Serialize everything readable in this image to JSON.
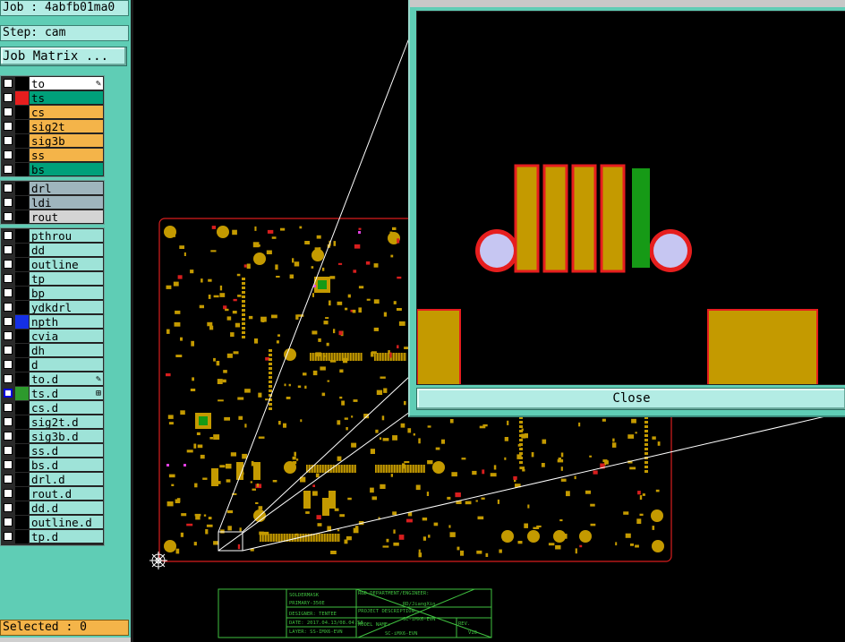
{
  "job_label": "Job : 4abfb01ma0",
  "step_label": "Step: cam",
  "job_matrix_button": "Job Matrix ...",
  "selected_status": "Selected : 0",
  "close_button": "Close",
  "layer_groups": [
    [
      {
        "name": "to",
        "bg": "#ffffff",
        "swatch": "#000000",
        "mark": "edit"
      },
      {
        "name": "ts",
        "bg": "#00a07a",
        "swatch": "#e61e1e"
      },
      {
        "name": "cs",
        "bg": "#f4b449",
        "swatch": "#000000"
      },
      {
        "name": "sig2t",
        "bg": "#f4b449",
        "swatch": "#000000"
      },
      {
        "name": "sig3b",
        "bg": "#f4b449",
        "swatch": "#000000"
      },
      {
        "name": "ss",
        "bg": "#f4b449",
        "swatch": "#000000"
      },
      {
        "name": "bs",
        "bg": "#00a07a",
        "swatch": "#000000"
      }
    ],
    [
      {
        "name": "drl",
        "bg": "#9fb5bd",
        "swatch": "#000000"
      },
      {
        "name": "ldi",
        "bg": "#9fb5bd",
        "swatch": "#000000"
      },
      {
        "name": "rout",
        "bg": "#d4d4d4",
        "swatch": "#000000"
      }
    ],
    [
      {
        "name": "pthrou",
        "bg": "#9ee3d8",
        "swatch": "#000000"
      },
      {
        "name": "dd",
        "bg": "#9ee3d8",
        "swatch": "#000000"
      },
      {
        "name": "outline",
        "bg": "#9ee3d8",
        "swatch": "#000000"
      },
      {
        "name": "tp",
        "bg": "#9ee3d8",
        "swatch": "#000000"
      },
      {
        "name": "bp",
        "bg": "#9ee3d8",
        "swatch": "#000000"
      },
      {
        "name": "ydkdrl",
        "bg": "#9ee3d8",
        "swatch": "#000000"
      },
      {
        "name": "npth",
        "bg": "#9ee3d8",
        "swatch": "#1530e6"
      },
      {
        "name": "cvia",
        "bg": "#9ee3d8",
        "swatch": "#000000"
      },
      {
        "name": "dh",
        "bg": "#9ee3d8",
        "swatch": "#000000"
      },
      {
        "name": "d",
        "bg": "#9ee3d8",
        "swatch": "#000000"
      },
      {
        "name": "to.d",
        "bg": "#9ee3d8",
        "swatch": "#000000",
        "mark": "edit"
      },
      {
        "name": "ts.d",
        "bg": "#9ee3d8",
        "swatch": "#2d9a2d",
        "mark": "grid",
        "selected": true
      },
      {
        "name": "cs.d",
        "bg": "#9ee3d8",
        "swatch": "#000000"
      },
      {
        "name": "sig2t.d",
        "bg": "#9ee3d8",
        "swatch": "#000000"
      },
      {
        "name": "sig3b.d",
        "bg": "#9ee3d8",
        "swatch": "#000000"
      },
      {
        "name": "ss.d",
        "bg": "#9ee3d8",
        "swatch": "#000000"
      },
      {
        "name": "bs.d",
        "bg": "#9ee3d8",
        "swatch": "#000000"
      },
      {
        "name": "drl.d",
        "bg": "#9ee3d8",
        "swatch": "#000000"
      },
      {
        "name": "rout.d",
        "bg": "#9ee3d8",
        "swatch": "#000000"
      },
      {
        "name": "dd.d",
        "bg": "#9ee3d8",
        "swatch": "#000000"
      },
      {
        "name": "outline.d",
        "bg": "#9ee3d8",
        "swatch": "#000000"
      },
      {
        "name": "tp.d",
        "bg": "#9ee3d8",
        "swatch": "#000000"
      }
    ]
  ],
  "title_block": {
    "soldermask": "SOLDERMASK",
    "primary": "PRIMARY-350E",
    "rd_dept": "R&D DEPARTMENT/ENGINEER:",
    "engineer": "RD/JiangXin",
    "designer_label": "DESIGNER: TENTEE",
    "proj_desc_label": "PROJECT DESCRIPTION:",
    "proj_desc": "SC-iMX6-EVN",
    "date_label": "DATE: 2017.04.13/08.04.58",
    "model_label": "MODEL NAME:",
    "model": "SC-iMX6-EVN",
    "rev_label": "REV.",
    "rev": "V10",
    "layer_label": "LAYER: SS-IMX6-EVN"
  },
  "colors": {
    "pcb_outline": "#d81e1e",
    "pad": "#c49a00",
    "pad_green": "#169a16",
    "zoom_window_frame": "#5fcdb5",
    "panel_bg": "#5fcdb5",
    "selected_status_bg": "#f4b449",
    "title_block_green": "#3fbf3f"
  },
  "icons": {
    "edit_mark": "pencil-icon",
    "grid_mark": "grid-icon",
    "origin_marker": "crosshair-target-icon"
  }
}
